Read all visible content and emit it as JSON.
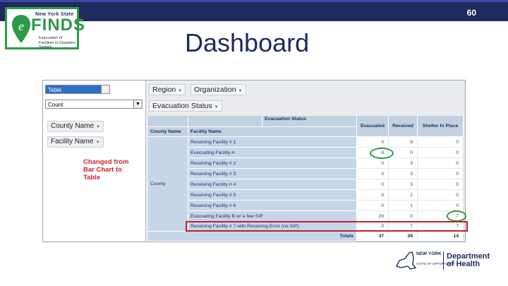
{
  "slide": {
    "number": "60",
    "title": "Dashboard"
  },
  "logo": {
    "state": "New York State",
    "name": "FINDS",
    "subtitle": "Evacuation of Facilities In Disasters System"
  },
  "left_panel": {
    "view_select": "Table",
    "measure_select": "Count",
    "row_chips": [
      "County Name",
      "Facility Name"
    ],
    "note": "Changed from Bar Chart to Table"
  },
  "filters": {
    "top": [
      "Region",
      "Organization"
    ],
    "columns": [
      "Evacuation Status"
    ]
  },
  "table": {
    "group_header": "Evacuation Status",
    "headers": [
      "County Name",
      "Facility Name",
      "Evacuated",
      "Received",
      "Shelter In Place"
    ],
    "county": "County",
    "rows": [
      {
        "name": "Receiving Facility # 1",
        "evacuated": "0",
        "received": "9",
        "sip": "0"
      },
      {
        "name": "Evacuating Facility A",
        "evacuated": "8",
        "received": "0",
        "sip": "0"
      },
      {
        "name": "Receiving Facility # 2",
        "evacuated": "0",
        "received": "3",
        "sip": "0"
      },
      {
        "name": "Receiving Facility # 3",
        "evacuated": "0",
        "received": "3",
        "sip": "0"
      },
      {
        "name": "Receiving Facility # 4",
        "evacuated": "0",
        "received": "3",
        "sip": "0"
      },
      {
        "name": "Receiving Facility # 5",
        "evacuated": "0",
        "received": "2",
        "sip": "0"
      },
      {
        "name": "Receiving Facility # 6",
        "evacuated": "0",
        "received": "1",
        "sip": "0"
      },
      {
        "name": "Evacuating Facility B w/ a few SIP",
        "evacuated": "29",
        "received": "0",
        "sip": "7"
      },
      {
        "name": "Receiving Facility # 7 with Receiving Error (no SIP)",
        "evacuated": "0",
        "received": "7",
        "sip": "7"
      }
    ],
    "totals": {
      "label": "Totals",
      "evacuated": "37",
      "received": "29",
      "sip": "14"
    }
  },
  "footer": {
    "nys": "NEW YORK",
    "nys_sub": "STATE OF OPPORTUNITY.",
    "dept": "Department",
    "dept2": "of Health"
  },
  "colors": {
    "navy": "#1f2a5e",
    "green": "#2e9a48",
    "red": "#c41f24",
    "cell_blue": "#c6d6e8"
  }
}
